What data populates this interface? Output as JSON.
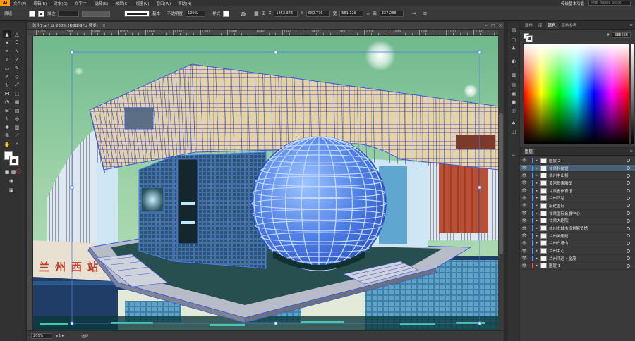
{
  "menubar": {
    "logo": "Ai",
    "items": [
      "文件(F)",
      "编辑(E)",
      "对象(O)",
      "文字(T)",
      "选择(S)",
      "效果(C)",
      "视图(V)",
      "窗口(W)",
      "帮助(H)"
    ],
    "workspace": "传统基本功能",
    "search_placeholder": "搜索 Adobe Stock"
  },
  "controlbar": {
    "group_label": "编组",
    "stroke_label": "描边",
    "stroke_style": "基本",
    "opacity_label": "不透明度",
    "opacity_value": "100%",
    "style_label": "样式",
    "x_label": "X",
    "x_value": "1853.346",
    "y_label": "Y",
    "y_value": "682.776",
    "w_label": "宽",
    "w_value": "581.128",
    "h_label": "高",
    "h_value": "337.288"
  },
  "document": {
    "tab_title": "兰州7.ai* @ 200% (RGB/GPU 预览)",
    "ruler_ticks": [
      "1520",
      "1560",
      "1600",
      "1640",
      "1680",
      "1720",
      "1760",
      "1800",
      "1840",
      "1880",
      "1920",
      "1960",
      "2000",
      "2040",
      "2080",
      "2120",
      "2160"
    ],
    "zoom": "200%",
    "status_tool": "选择",
    "sign_text": "兰州西站"
  },
  "color_panel": {
    "tabs": [
      "属性",
      "库",
      "颜色",
      "颜色参考"
    ],
    "active_tab": "颜色",
    "hex_label": "#",
    "hex_value": "EEEEEE"
  },
  "layers_panel": {
    "tab": "图层",
    "layers": [
      {
        "name": "图层 2",
        "color": "#4f93ff",
        "selected": false,
        "expandable": true
      },
      {
        "name": "甘肃科技馆",
        "color": "#4f93ff",
        "selected": true,
        "expandable": true
      },
      {
        "name": "兰州中山桥",
        "color": "#4f93ff",
        "selected": false,
        "expandable": true
      },
      {
        "name": "黄河母亲雕塑",
        "color": "#4f93ff",
        "selected": false,
        "expandable": true
      },
      {
        "name": "甘肃省体育馆",
        "color": "#4f93ff",
        "selected": false,
        "expandable": true
      },
      {
        "name": "兰州西站",
        "color": "#4f93ff",
        "selected": false,
        "expandable": true
      },
      {
        "name": "宏建国际",
        "color": "#4f93ff",
        "selected": false,
        "expandable": true
      },
      {
        "name": "甘肃国际会展中心",
        "color": "#4f93ff",
        "selected": false,
        "expandable": true
      },
      {
        "name": "甘肃大剧院",
        "color": "#4f93ff",
        "selected": false,
        "expandable": true
      },
      {
        "name": "兰州市城市规划展览馆",
        "color": "#4f93ff",
        "selected": false,
        "expandable": true
      },
      {
        "name": "兰州美術館",
        "color": "#4f93ff",
        "selected": false,
        "expandable": true
      },
      {
        "name": "兰州白塔山",
        "color": "#4f93ff",
        "selected": false,
        "expandable": true
      },
      {
        "name": "兰州中心",
        "color": "#4f93ff",
        "selected": false,
        "expandable": true
      },
      {
        "name": "兰州鸿运・金茂",
        "color": "#4f93ff",
        "selected": false,
        "expandable": true
      },
      {
        "name": "图层 1",
        "color": "#ff4040",
        "selected": false,
        "expandable": true
      }
    ]
  }
}
